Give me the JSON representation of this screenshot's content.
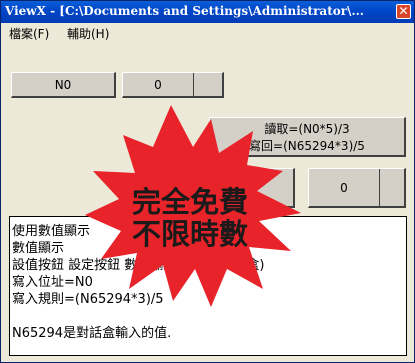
{
  "window": {
    "title": "ViewX - [C:\\Documents and Settings\\Administrator\\..."
  },
  "menu": [
    {
      "label": "檔案(F)"
    },
    {
      "label": "輔助(H)"
    }
  ],
  "buttons": {
    "n0": "N0",
    "value1": "0",
    "read_write_line1": "讀取=(N0*5)/3",
    "read_write_line2": "寫回=(N65294*3)/5",
    "value2": "0"
  },
  "textbox": {
    "lines": [
      "使用數值顯示",
      "數值顯示",
      "設值按鈕 設定按鈕 數值輸入(值輸入對話盒)",
      "寫入位址=N0",
      "寫入規則=(N65294*3)/5",
      "",
      "N65294是對話盒輸入的值."
    ]
  },
  "promo": {
    "line1": "完全免費",
    "line2": "不限時數",
    "color": "#e8232a"
  }
}
